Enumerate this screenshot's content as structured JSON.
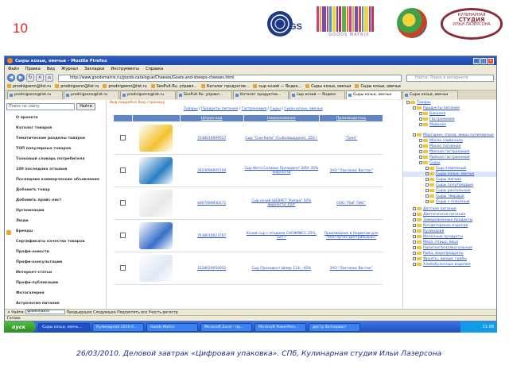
{
  "slide": {
    "number": "10",
    "caption": "26/03/2010. Деловой завтрак «Цифровая упаковка». СПб, Кулинарная студия Ильи Лазерсона"
  },
  "logos": {
    "gs1": "GS1",
    "goods_matrix": "GOODS MATRIX",
    "studio_line1": "КУЛИНАРНАЯ",
    "studio_line2": "СТУДИЯ",
    "studio_line3": "ИЛЬИ ЛАЗЕРСОНА",
    "barcode_colors": [
      "#d93b8a",
      "#f0a33a",
      "#7a4fa8",
      "#e0443a",
      "#3c9ad0",
      "#f3d23c",
      "#8e3a9c",
      "#c42c5a",
      "#5fb04a",
      "#e76f28"
    ]
  },
  "browser": {
    "title": "Сыры козьи, овечьи - Mozilla Firefox",
    "menu": [
      "Файл",
      "Правка",
      "Вид",
      "Журнал",
      "Закладки",
      "Инструменты",
      "Справка"
    ],
    "url": "http://www.goodsmatrix.ru/goods-catalogue/Cheeses/Goats-and-sheeps-cheeses.html",
    "search_placeholder": "Найти: Поиск в интернете",
    "bookmarks": [
      "prodnigsenn@list.ru",
      "prodnigsenn@list.ru",
      "prodnigsenn@list.ru",
      "SeoPult.Ru: управл...",
      "Каталог продуктов...",
      "сыр козий — Яндек...",
      "Сыры козьи, овечьи",
      "Сыры козьи, овечьи"
    ],
    "tabs": [
      "prodnigsenn@list.ru",
      "prodnigsenn@list.ru",
      "prodnigsenn@list.ru",
      "SeoPult.Ru: управл...",
      "Каталог продуктов...",
      "сыр козий — Яндекс",
      "Сыры козьи, овечьи",
      "Сыры козьи, овечьи"
    ],
    "find_label": "Найти:",
    "find_value": "goodsmatrix",
    "find_prev": "Предыдущее",
    "find_next": "Следующее",
    "find_highlight": "Подсветить все",
    "find_case": "Учесть регистр",
    "status": "Готово"
  },
  "leftpanel": {
    "search_value": "Поиск по сайту",
    "search_button": "Найти",
    "items": [
      "О проекте",
      "Каталог товаров",
      "Тематические разделы товаров",
      "ТОП популярных товаров",
      "Толковый словарь потребителя",
      "100 последних отзывов",
      "Последние коммерческие объявления",
      "Добавить товар",
      "Добавить прайс-лист",
      "Организации",
      "Люди",
      "Бренды",
      "Сертификаты качества товаров",
      "Профи-новости",
      "Профи-консультации",
      "Интернет-статьи",
      "Профи-публикации",
      "Фотогалерея",
      "Астрология питания"
    ]
  },
  "main": {
    "note": "Вид подробно Вид страницу",
    "breadcrumbs": [
      "Товары",
      "Продукты питания",
      "Гастрономия",
      "Сыры",
      "Сыры козьи, овечьи"
    ],
    "columns": [
      "Штрих-код",
      "Наименование",
      "Производитель"
    ],
    "rows": [
      {
        "barcode": "7038010009557",
        "name": "Сыр \"Сни-Капи\" (Сыболицадное), 250 г",
        "maker": "\"Тине\"",
        "img": "#f2c230"
      },
      {
        "barcode": "3023090005100",
        "name": "Сыр Фета Салакис Президент 200г 35% жирности",
        "maker": "ЗАО \"Лактапис Восток\"",
        "img": "#2a7ec2"
      },
      {
        "barcode": "4607089930371",
        "name": "Сыр козий ШЕВРЕТ \"Кипра\" 50% жирности 150г",
        "maker": "ООО \"ПЫГ-ПИС\"",
        "img": "#e8e8e8"
      },
      {
        "barcode": "7038010023767",
        "name": "Козий сыр с ягодами СНОФРИСС 25%, 125 г",
        "maker": "Произведено в Норвегии для \"ХОО Артис-Дистрибьюшн\"",
        "img": "#3a70c8"
      },
      {
        "barcode": "3228020950052",
        "name": "Сыр Президент Шевр 113г, 45%",
        "maker": "ЗАО \"Лактапис Восток\"",
        "img": "#dfe8f5"
      }
    ]
  },
  "tree": {
    "items": [
      {
        "label": "Товары",
        "level": 0
      },
      {
        "label": "Продукты питания",
        "level": 1
      },
      {
        "label": "Бакалея",
        "level": 2
      },
      {
        "label": "Гастрономия",
        "level": 2
      },
      {
        "label": "Майонез",
        "level": 2
      },
      {
        "label": "Маргарин, спред, жиры кулинарные",
        "level": 1
      },
      {
        "label": "Масло сливочное",
        "level": 2
      },
      {
        "label": "Масло топленое",
        "level": 2
      },
      {
        "label": "Мясная гастрономия",
        "level": 2
      },
      {
        "label": "Рыбная гастрономия",
        "level": 2
      },
      {
        "label": "Сыры",
        "level": 2
      },
      {
        "label": "Сыр плавленый",
        "level": 3
      },
      {
        "label": "Сыры козьи, овечьи",
        "level": 3
      },
      {
        "label": "Сыры мягкие",
        "level": 3
      },
      {
        "label": "Сыры полутвердые",
        "level": 3
      },
      {
        "label": "Сыры рассольные",
        "level": 3
      },
      {
        "label": "Сыры твердые",
        "level": 3
      },
      {
        "label": "Сыры с плесенью",
        "level": 3
      },
      {
        "label": "Детское питание",
        "level": 1
      },
      {
        "label": "Диетическое питание",
        "level": 1
      },
      {
        "label": "Замороженные продукты",
        "level": 1
      },
      {
        "label": "Кондитерские изделия",
        "level": 1
      },
      {
        "label": "Кулинария",
        "level": 1
      },
      {
        "label": "Молочные продукты",
        "level": 1
      },
      {
        "label": "Мясо, птица, яйцо",
        "level": 1
      },
      {
        "label": "Напитки безалкогольные",
        "level": 1
      },
      {
        "label": "Рыба, морепродукты",
        "level": 1
      },
      {
        "label": "Фрукты, овощи, грибы",
        "level": 1
      },
      {
        "label": "Хлебобулочные изделия",
        "level": 1
      }
    ]
  },
  "taskbar": {
    "start": "пуск",
    "tasks": [
      "Сыры козьи, овечь...",
      "Кулинарная 2010-0...",
      "Goods Matrix",
      "Microsoft Excel - пр...",
      "Microsoft PowerPoin...",
      "дистр Ватсервис!"
    ],
    "clock": "11:08"
  }
}
